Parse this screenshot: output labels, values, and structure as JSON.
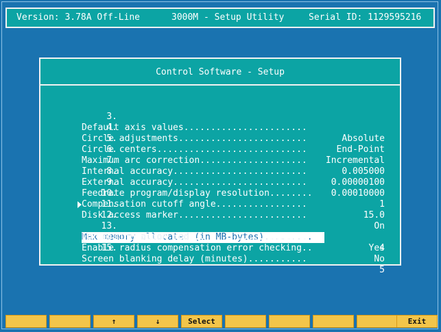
{
  "header": {
    "version": "Version: 3.78A Off-Line",
    "title": "3000M - Setup Utility",
    "serial": "Serial ID: 1129595216"
  },
  "dialog": {
    "title": "Control Software - Setup",
    "items": [
      {
        "num": "3.",
        "label": "Default axis values.......................",
        "value": "Absolute"
      },
      {
        "num": "4.",
        "label": "Circle adjustments........................",
        "value": "End-Point"
      },
      {
        "num": "5.",
        "label": "Circle centers............................",
        "value": "Incremental"
      },
      {
        "num": "6.",
        "label": "Maximum arc correction....................",
        "value": "0.005000"
      },
      {
        "num": "7.",
        "label": "Internal accuracy.........................",
        "value": "0.00000100"
      },
      {
        "num": "8.",
        "label": "External accuracy.........................",
        "value": "0.00010000"
      },
      {
        "num": "9.",
        "label": "Feedrate program/display resolution........",
        "value": "1"
      },
      {
        "num": "10.",
        "label": "Compensation cutoff angle.................",
        "value": "15.0"
      },
      {
        "num": "11.",
        "label": "Disk access marker........................",
        "value": "On"
      },
      {
        "num": "12.",
        "label": "Max memory allocated (in MB-bytes).........",
        "value": "4"
      },
      {
        "num": "13.",
        "label": "Force simulation mode.....................",
        "value": "Yes"
      },
      {
        "num": "14.",
        "label": "Enable radius compensation error checking..",
        "value": "No"
      },
      {
        "num": "15.",
        "label": "Screen blanking delay (minutes)...........",
        "value": "5"
      }
    ],
    "selected_index": 9
  },
  "function_keys": [
    {
      "label": ""
    },
    {
      "label": ""
    },
    {
      "label": "↑"
    },
    {
      "label": "↓"
    },
    {
      "label": "Select"
    },
    {
      "label": ""
    },
    {
      "label": ""
    },
    {
      "label": ""
    },
    {
      "label": ""
    },
    {
      "label": "Exit"
    }
  ],
  "colors": {
    "background": "#1a73b0",
    "panel": "#0ca4a4",
    "function_key": "#f3c54a",
    "selection": "#ffffff"
  }
}
